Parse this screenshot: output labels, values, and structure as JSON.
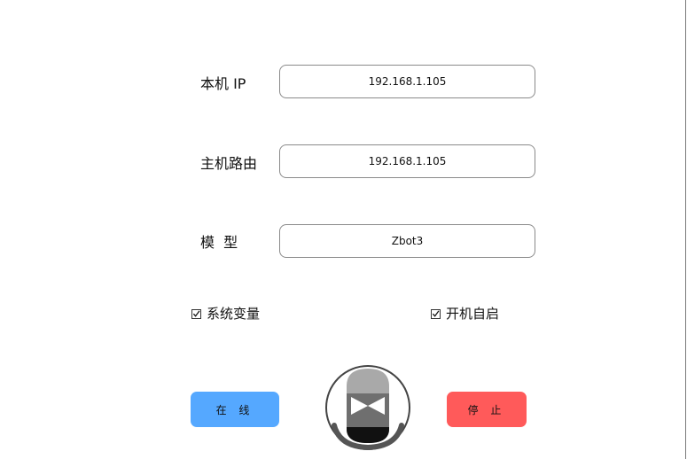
{
  "form": {
    "ip": {
      "label": "本机 IP",
      "value": "192.168.1.105"
    },
    "route": {
      "label": "主机路由",
      "value": "192.168.1.105"
    },
    "model": {
      "label": "模  型",
      "value": "Zbot3"
    }
  },
  "options": {
    "env": {
      "label": "系统变量",
      "checked": true
    },
    "autostart": {
      "label": "开机自启",
      "checked": true
    }
  },
  "buttons": {
    "online": "在 线",
    "stop": "停 止"
  },
  "colors": {
    "online": "#55a8ff",
    "stop": "#ff5a5a"
  },
  "icons": {
    "checkmark": "checkmark-icon",
    "mic": "microphone-play-icon"
  }
}
